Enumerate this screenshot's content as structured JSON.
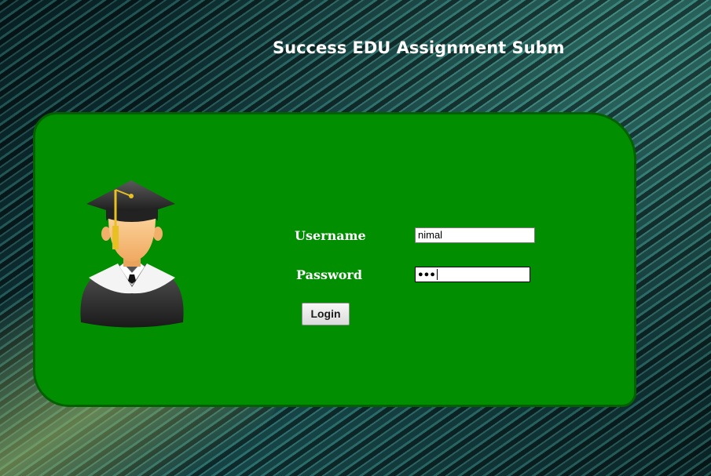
{
  "header": {
    "title": "Success EDU Assignment Submissi"
  },
  "login_form": {
    "username_label": "Username",
    "username_value": "nimal",
    "password_label": "Password",
    "password_masked": "●●●",
    "login_label": "Login"
  },
  "colors": {
    "panel_green": "#018e00",
    "panel_border": "#016000",
    "text_white": "#ffffff"
  },
  "icons": {
    "avatar": "graduate-avatar-icon"
  }
}
